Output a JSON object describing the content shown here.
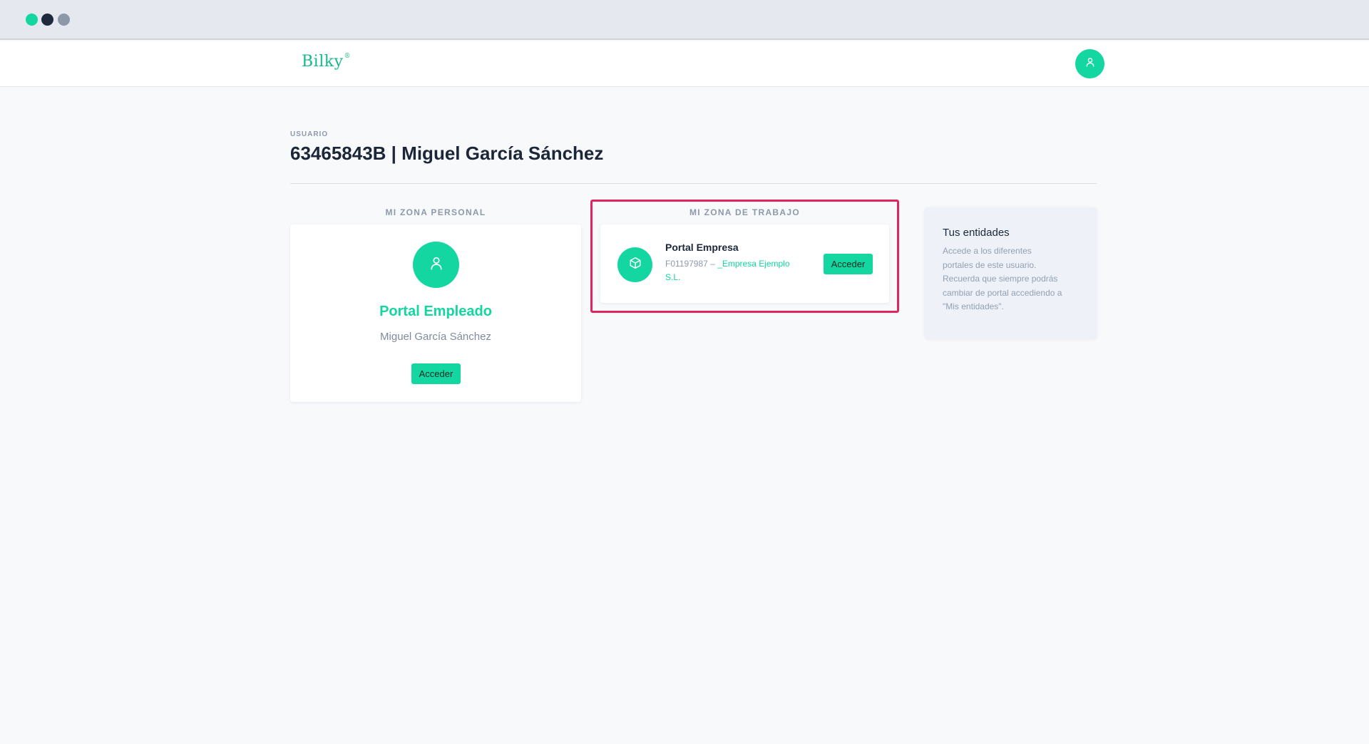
{
  "app": {
    "logo_text": "Bilky",
    "logo_mark": "®",
    "accent_color": "#13d6a0",
    "highlight_color": "#e0245e",
    "user_icon": "user-icon"
  },
  "header": {
    "eyebrow": "USUARIO",
    "title": "63465843B | Miguel García Sánchez"
  },
  "personal_zone": {
    "label": "MI ZONA PERSONAL",
    "icon": "user-icon",
    "portal_name": "Portal Empleado",
    "user_name": "Miguel García Sánchez",
    "button_label": "Acceder"
  },
  "work_zone": {
    "label": "MI ZONA DE TRABAJO",
    "icon": "cube-icon",
    "portal_name": "Portal Empresa",
    "company_id": "F01197987 –",
    "company_name_line1": "_Empresa Ejemplo",
    "company_name_line2": "S.L.",
    "button_label": "Acceder"
  },
  "entities_panel": {
    "title": "Tus entidades",
    "description_lines": [
      "Accede a los diferentes",
      "portales de este usuario.",
      "Recuerda que siempre podrás",
      "cambiar de portal accediendo a",
      "\"Mis entidades\"."
    ]
  }
}
